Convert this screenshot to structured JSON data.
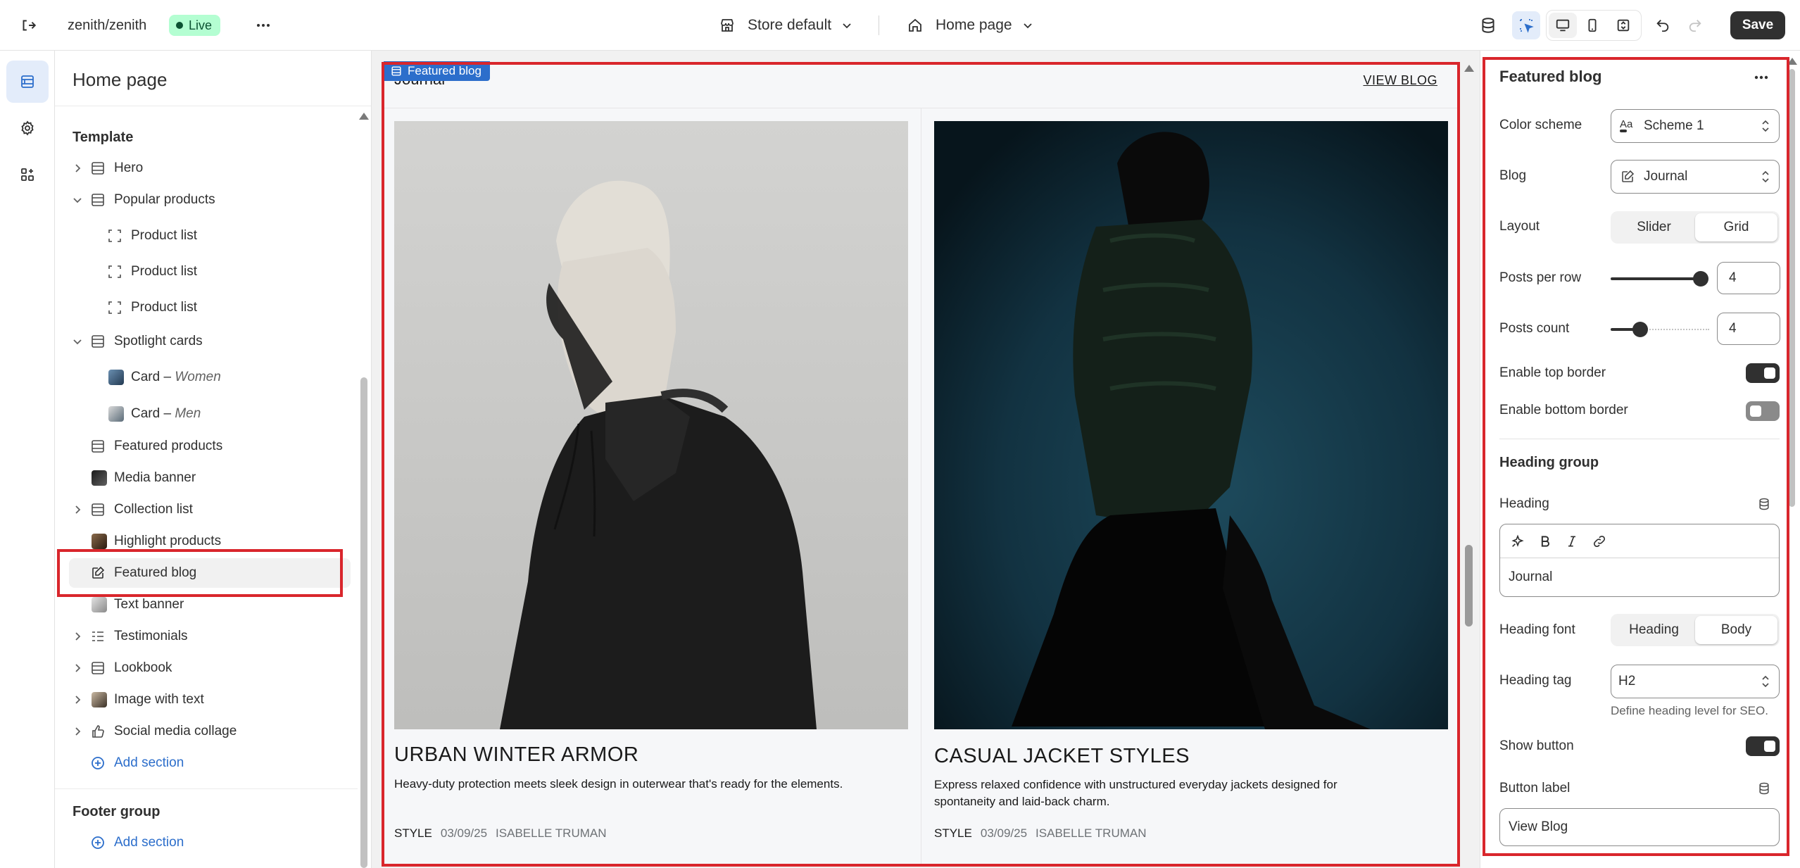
{
  "topbar": {
    "store_name": "zenith/zenith",
    "status_badge": "Live",
    "theme_selector": "Store default",
    "page_selector": "Home page",
    "save_label": "Save"
  },
  "left_panel": {
    "title": "Home page",
    "template_heading": "Template",
    "items": [
      {
        "label": "Hero"
      },
      {
        "label": "Popular products"
      },
      {
        "label": "Product list"
      },
      {
        "label": "Product list"
      },
      {
        "label": "Product list"
      },
      {
        "label": "Spotlight cards"
      },
      {
        "label": "Card –",
        "sub": "Women"
      },
      {
        "label": "Card –",
        "sub": "Men"
      },
      {
        "label": "Featured products"
      },
      {
        "label": "Media banner"
      },
      {
        "label": "Collection list"
      },
      {
        "label": "Highlight products"
      },
      {
        "label": "Featured blog"
      },
      {
        "label": "Text banner"
      },
      {
        "label": "Testimonials"
      },
      {
        "label": "Lookbook"
      },
      {
        "label": "Image with text"
      },
      {
        "label": "Social media collage"
      }
    ],
    "add_section": "Add section",
    "footer_heading": "Footer group",
    "footer_add_section": "Add section"
  },
  "preview": {
    "section_tag": "Featured blog",
    "heading": "Journal",
    "view_blog": "VIEW BLOG",
    "posts": [
      {
        "title": "URBAN WINTER ARMOR",
        "excerpt": "Heavy-duty protection meets sleek design in outerwear that's ready for the elements.",
        "category": "STYLE",
        "date": "03/09/25",
        "author": "ISABELLE TRUMAN"
      },
      {
        "title": "CASUAL JACKET STYLES",
        "excerpt": "Express relaxed confidence with unstructured everyday jackets designed for spontaneity and laid-back charm.",
        "category": "STYLE",
        "date": "03/09/25",
        "author": "ISABELLE TRUMAN"
      }
    ]
  },
  "right_panel": {
    "title": "Featured blog",
    "color_scheme_label": "Color scheme",
    "color_scheme_value": "Scheme 1",
    "blog_label": "Blog",
    "blog_value": "Journal",
    "layout_label": "Layout",
    "layout_options": [
      "Slider",
      "Grid"
    ],
    "layout_selected": "Grid",
    "posts_per_row_label": "Posts per row",
    "posts_per_row_value": "4",
    "posts_per_row_level": 1.0,
    "posts_count_label": "Posts count",
    "posts_count_value": "4",
    "posts_count_level": 0.3,
    "top_border_label": "Enable top border",
    "top_border_on": true,
    "bottom_border_label": "Enable bottom border",
    "bottom_border_on": false,
    "heading_group_title": "Heading group",
    "heading_label": "Heading",
    "heading_value": "Journal",
    "heading_font_label": "Heading font",
    "heading_font_options": [
      "Heading",
      "Body"
    ],
    "heading_font_selected": "Body",
    "heading_tag_label": "Heading tag",
    "heading_tag_value": "H2",
    "heading_tag_help": "Define heading level for SEO.",
    "show_button_label": "Show button",
    "show_button_on": true,
    "button_label_label": "Button label",
    "button_label_value": "View Blog"
  },
  "colors": {
    "accent": "#2c6ecb",
    "highlight": "#d9262c",
    "live_badge_bg": "#b4fed2",
    "toggle_on": "#303030",
    "toggle_off": "#8a8a8a"
  }
}
